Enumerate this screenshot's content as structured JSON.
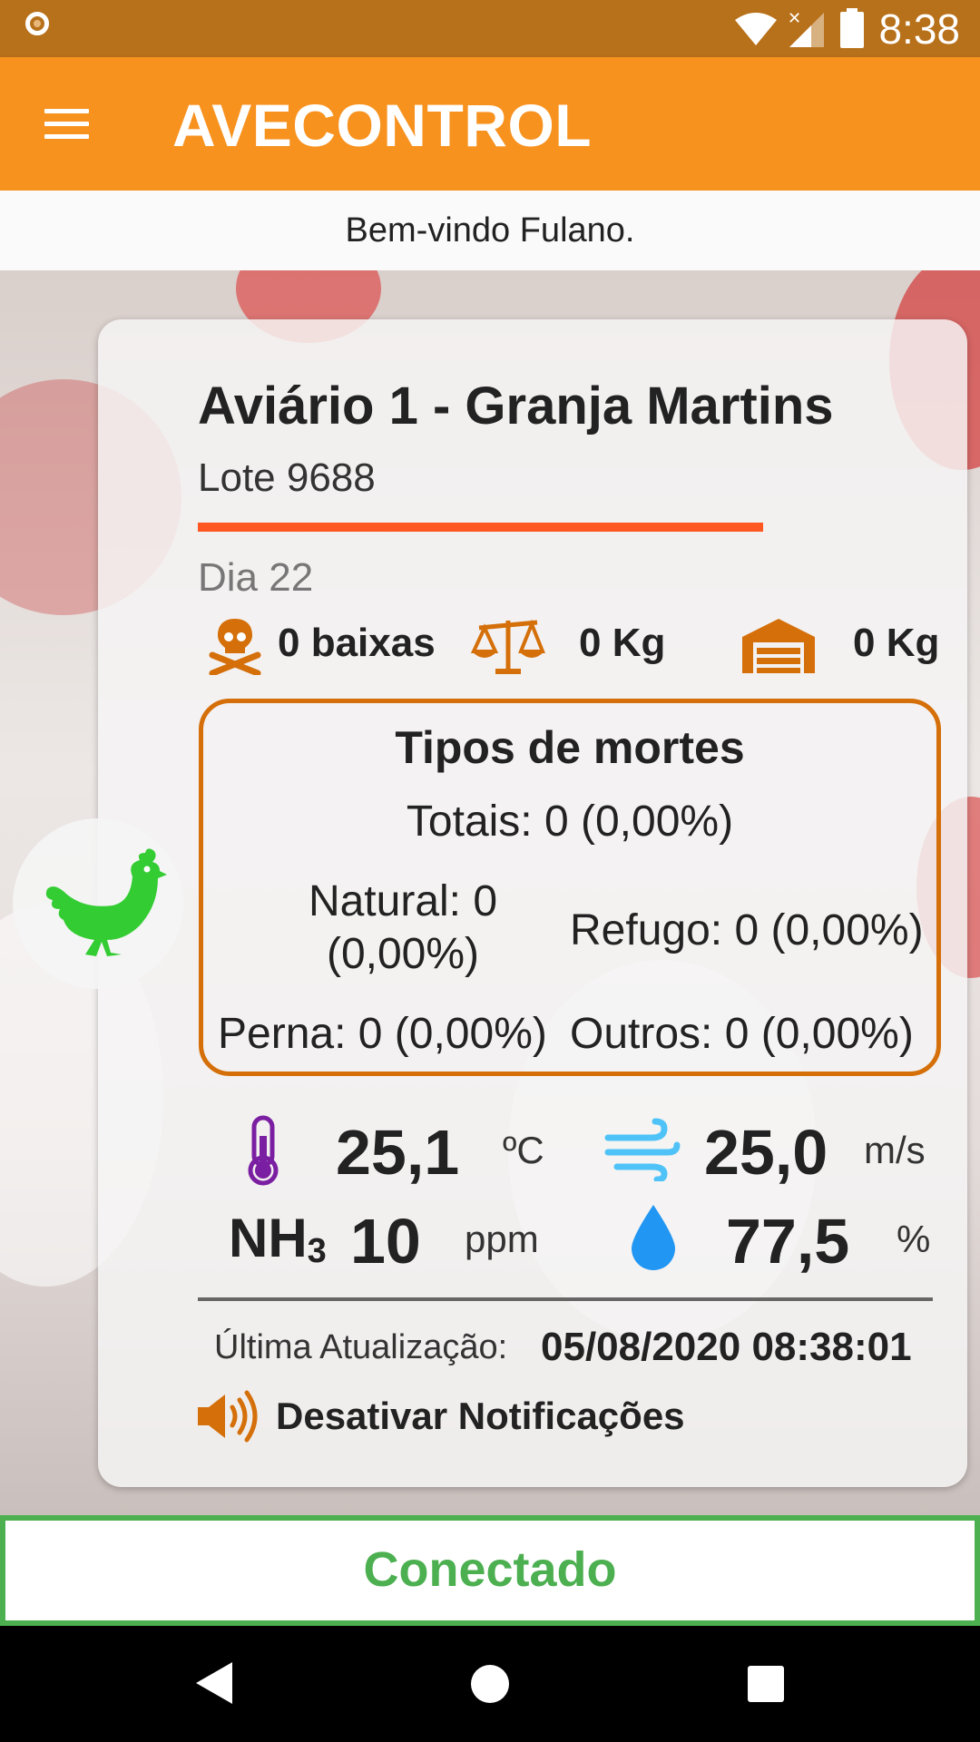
{
  "status_bar": {
    "time": "8:38"
  },
  "app_bar": {
    "title": "AVECONTROL",
    "menu_icon": "menu-icon"
  },
  "welcome": "Bem-vindo Fulano.",
  "card": {
    "title": "Aviário 1 - Granja Martins",
    "lote": "Lote 9688",
    "dia": "Dia 22",
    "progress": 0.65,
    "stats": {
      "baixas": "0 baixas",
      "peso": "0 Kg",
      "silo": "0 Kg"
    },
    "mortes": {
      "title": "Tipos de mortes",
      "totais": "Totais: 0 (0,00%)",
      "natural_line1": "Natural: 0",
      "natural_line2": "(0,00%)",
      "refugo": "Refugo: 0 (0,00%)",
      "perna": "Perna: 0 (0,00%)",
      "outros": "Outros: 0 (0,00%)"
    },
    "sensors": {
      "temperatura": {
        "value": "25,1",
        "unit": "ºC"
      },
      "vento": {
        "value": "25,0",
        "unit": "m/s"
      },
      "nh3": {
        "label": "NH",
        "sub": "3",
        "value": "10",
        "unit": "ppm"
      },
      "umidade": {
        "value": "77,5",
        "unit": "%"
      }
    },
    "ultima_atualizacao": {
      "label": "Última Atualização:",
      "value": "05/08/2020 08:38:01"
    },
    "notificacoes": "Desativar Notificações"
  },
  "connection": "Conectado",
  "colors": {
    "status_bar": "#B8711B",
    "app_bar": "#F7921F",
    "accent_orange": "#D46F09",
    "progress": "#FF5722",
    "connected": "#4CAF50",
    "chicken": "#33CC33",
    "wind": "#4FC3F7",
    "drop": "#2196F3",
    "thermo": "#7B1FA2"
  }
}
